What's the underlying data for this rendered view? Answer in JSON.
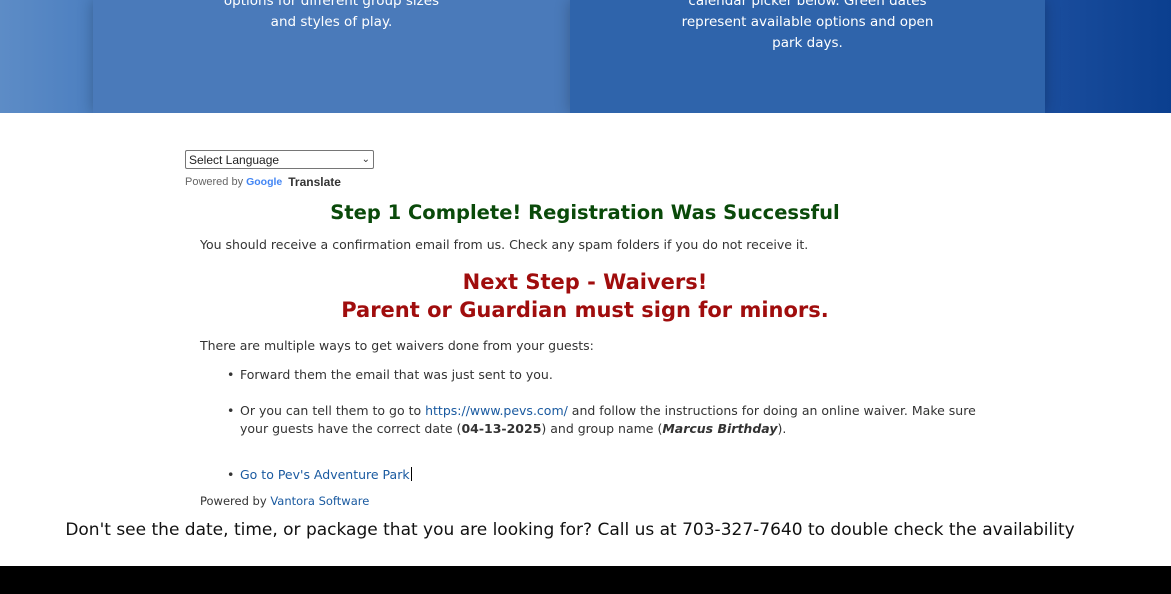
{
  "banner": {
    "panel1_lines": [
      "options for different group sizes",
      "and styles of play."
    ],
    "panel2_lines": [
      "calendar picker below. Green dates",
      "represent available options and open",
      "park days."
    ]
  },
  "translate": {
    "select_value": "Select Language",
    "powered_by": "Powered by",
    "google": "Google",
    "translate_label": "Translate"
  },
  "content": {
    "step1_title": "Step 1 Complete! Registration Was Successful",
    "confirmation": "You should receive a confirmation email from us. Check any spam folders if you do not receive it.",
    "next_line1": "Next Step - Waivers!",
    "next_line2": "Parent or Guardian must sign for minors.",
    "ways_intro": "There are multiple ways to get waivers done from your guests:",
    "item1": "Forward them the email that was just sent to you.",
    "item2_prefix": "Or you can tell them to go to ",
    "item2_link": "https://www.pevs.com/",
    "item2_mid": " and follow the instructions for doing an online waiver. Make sure your guests have the correct date (",
    "item2_date": "04-13-2025",
    "item2_mid2": ") and group name (",
    "item2_group": "Marcus Birthday",
    "item2_end": ").",
    "item3_link": "Go to Pev's Adventure Park",
    "powered_by": "Powered by ",
    "vendor_link": "Vantora Software"
  },
  "footer": {
    "note": "Don't see the date, time, or package that you are looking for? Call us at 703-327-7640 to double check the availability"
  }
}
